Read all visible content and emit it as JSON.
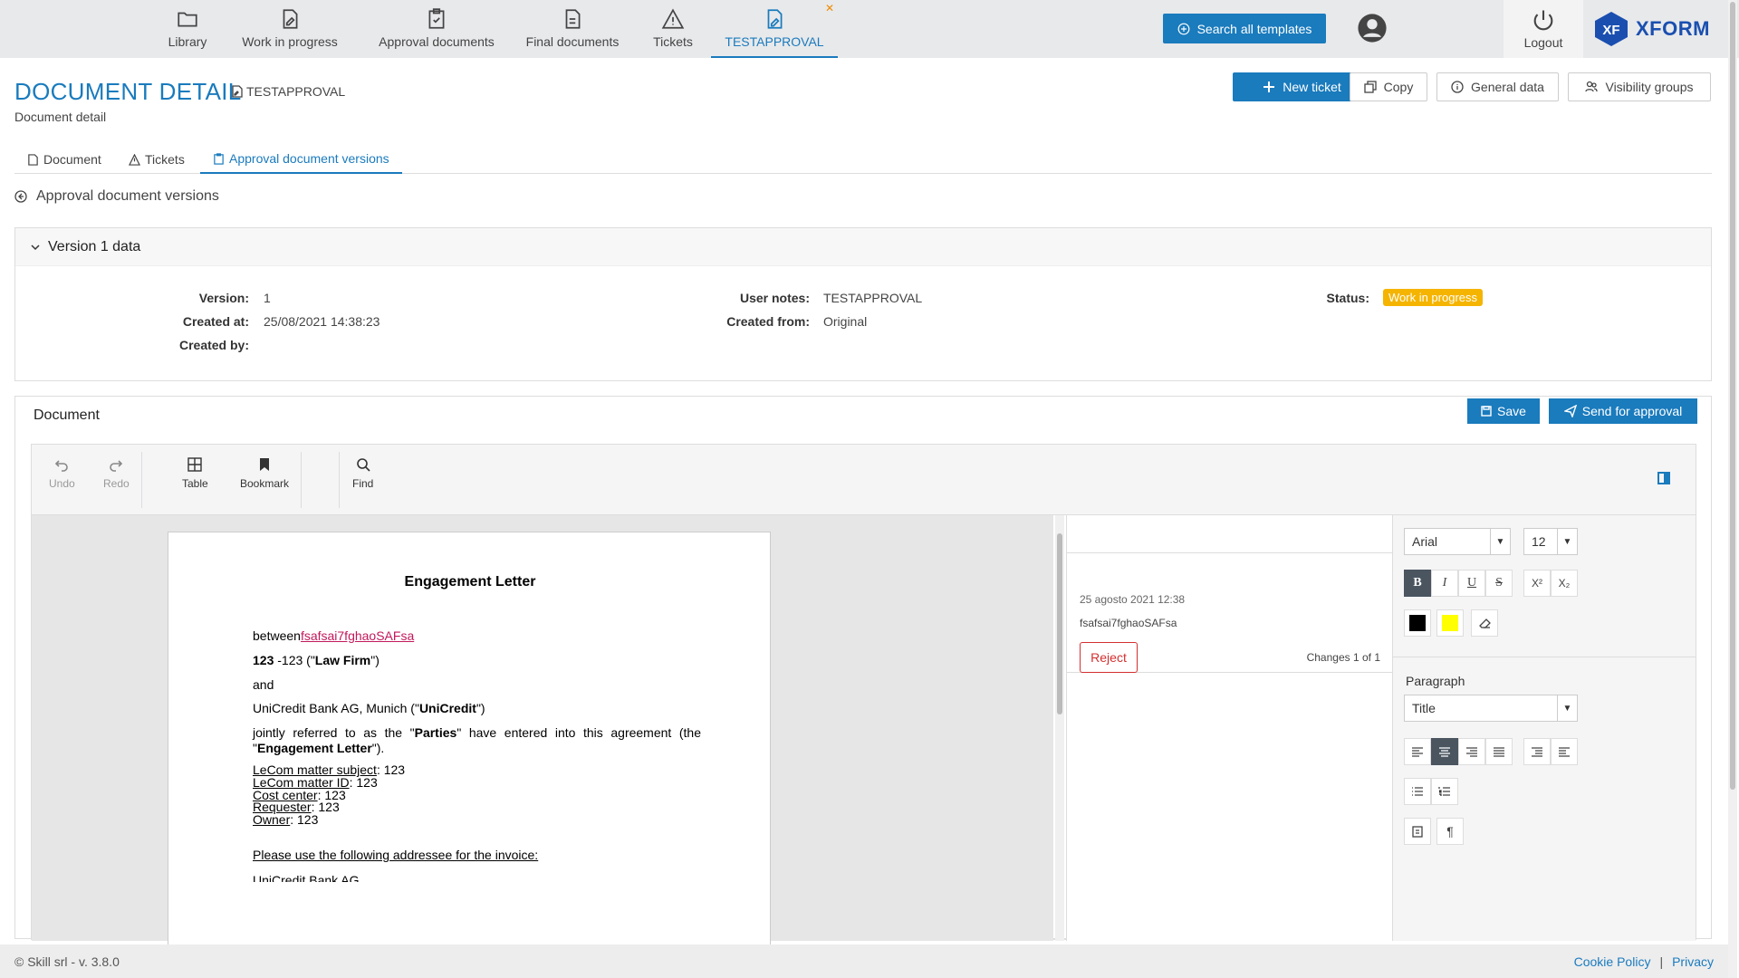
{
  "nav": {
    "items": [
      {
        "label": "Library",
        "icon": "folder-icon"
      },
      {
        "label": "Work in progress",
        "icon": "edit-document-icon"
      },
      {
        "label": "Approval documents",
        "icon": "clipboard-check-icon"
      },
      {
        "label": "Final documents",
        "icon": "final-document-icon"
      },
      {
        "label": "Tickets",
        "icon": "warning-icon"
      },
      {
        "label": "TESTAPPROVAL",
        "icon": "document-edit-icon"
      }
    ],
    "search_label": "Search all templates",
    "logout_label": "Logout",
    "brand": "XFORM",
    "brand_mark": "XF"
  },
  "header": {
    "title": "DOCUMENT DETAIL",
    "doc_name": "TESTAPPROVAL",
    "subtitle": "Document detail",
    "buttons": {
      "new_ticket": "New ticket",
      "copy": "Copy",
      "general_data": "General data",
      "visibility_groups": "Visibility groups"
    }
  },
  "tabs": [
    {
      "label": "Document"
    },
    {
      "label": "Tickets"
    },
    {
      "label": "Approval document versions"
    }
  ],
  "back_label": "Approval document versions",
  "version": {
    "header": "Version 1 data",
    "version_label": "Version:",
    "version_value": "1",
    "created_at_label": "Created at:",
    "created_at_value": "25/08/2021 14:38:23",
    "created_by_label": "Created by:",
    "user_notes_label": "User notes:",
    "user_notes_value": "TESTAPPROVAL",
    "created_from_label": "Created from:",
    "created_from_value": "Original",
    "status_label": "Status:",
    "status_value": "Work in progress",
    "status_color": "#f5b400"
  },
  "document": {
    "label": "Document",
    "save": "Save",
    "send": "Send for approval"
  },
  "toolbar": {
    "undo": "Undo",
    "redo": "Redo",
    "table": "Table",
    "bookmark": "Bookmark",
    "find": "Find"
  },
  "page": {
    "title": "Engagement Letter",
    "between": "between",
    "inserted": "fsafsai7fghaoSAFsa",
    "firm_num": "123",
    "firm_rest": " -123   (\"",
    "firm_name": "Law Firm",
    "firm_end": "\")",
    "and": "and",
    "bank_pre": "UniCredit Bank AG, Munich (\"",
    "bank_name": "UniCredit",
    "bank_end": "\")",
    "jointly_pre": "jointly referred to as the \"",
    "parties": "Parties",
    "jointly_mid": "\" have entered into this agreement (the \"",
    "engagement": "Engagement Letter",
    "jointly_end": "\").",
    "fields": [
      {
        "k": "LeCom matter subject",
        "v": ": 123"
      },
      {
        "k": "LeCom matter ID",
        "v": ": 123"
      },
      {
        "k": "Cost center",
        "v": ": 123"
      },
      {
        "k": "Requester",
        "v": ": 123"
      },
      {
        "k": "Owner",
        "v": ": 123"
      }
    ],
    "addressee": "Please use the following addressee for the invoice:",
    "cut": "UniCredit Bank AG"
  },
  "changes": {
    "date": "25 agosto 2021 12:38",
    "text": "fsafsai7fghaoSAFsa",
    "reject": "Reject",
    "count": "Changes 1 of 1"
  },
  "props": {
    "font": "Arial",
    "size": "12",
    "bold": "B",
    "italic": "I",
    "underline": "U",
    "strike": "S",
    "superscript": "X²",
    "subscript": "X₂",
    "font_color": "#000000",
    "highlight_color": "#ffff00",
    "paragraph_label": "Paragraph",
    "style": "Title",
    "pilcrow": "¶"
  },
  "footer": {
    "copyright": "© Skill srl - v. 3.8.0",
    "cookie": "Cookie Policy",
    "sep": "|",
    "privacy": "Privacy"
  }
}
